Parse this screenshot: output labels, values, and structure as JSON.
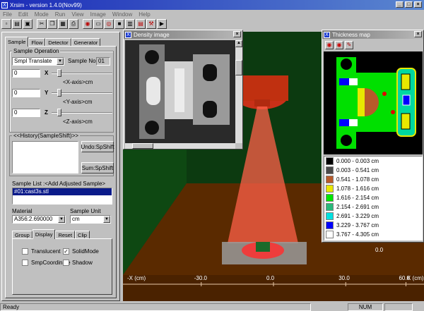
{
  "app": {
    "title": "Xrsim - version 1.4.0(Nov99)",
    "icon": "xray-app-icon"
  },
  "menu": [
    "File",
    "Edit",
    "Mode",
    "Run",
    "View",
    "Image",
    "Window",
    "Help"
  ],
  "toolbar": {
    "icons": [
      "new-icon",
      "open-icon",
      "save-icon",
      "cut-icon",
      "copy-icon",
      "paste-icon",
      "print-icon",
      "camera-icon",
      "display-icon",
      "record-icon",
      "stop-icon",
      "wall-icon",
      "film-icon",
      "tool-icon",
      "play-icon"
    ]
  },
  "left_panel": {
    "tabs": [
      "Sample",
      "Flow",
      "Detector",
      "Generator"
    ],
    "sample_operation": {
      "legend": "Sample Operation",
      "select_value": "Smpl Translate",
      "sample_no_label": "Sample No",
      "sample_no_value": "01"
    },
    "axes": [
      {
        "value": "0",
        "axis": "X",
        "caption": "<X-axis>cm"
      },
      {
        "value": "0",
        "axis": "Y",
        "caption": "<Y-axis>cm"
      },
      {
        "value": "0",
        "axis": "Z",
        "caption": "<Z-axis>cm"
      }
    ],
    "history": {
      "legend": "<<History(SampleShift)>>",
      "undo": "Undo:SpShift",
      "sum": "Sum:SpShift"
    },
    "sample_list": {
      "label": "Sample List :<Add Adjusted Sample>",
      "items": [
        "#01:cast3s.stl"
      ]
    },
    "material": {
      "label": "Material",
      "value": "A356:2.690000"
    },
    "sample_unit": {
      "label": "Sample Unit",
      "value": "cm"
    },
    "sub_tabs": [
      "Group",
      "Display",
      "Reset",
      "Clip"
    ],
    "checks": [
      {
        "label": "Translucent",
        "checked": false
      },
      {
        "label": "SolidMode",
        "checked": true
      },
      {
        "label": "SmpCoordinate",
        "checked": false
      },
      {
        "label": "Shadow",
        "checked": false
      }
    ]
  },
  "density_window": {
    "title": "Density image"
  },
  "thickness_window": {
    "title": "Thickness map",
    "legend": [
      {
        "color": "#000000",
        "label": "0.000 - 0.003 cm"
      },
      {
        "color": "#4a4a4a",
        "label": "0.003 - 0.541 cm"
      },
      {
        "color": "#b85a2a",
        "label": "0.541 - 1.078 cm"
      },
      {
        "color": "#e8e800",
        "label": "1.078 - 1.616 cm"
      },
      {
        "color": "#00e600",
        "label": "1.616 - 2.154 cm"
      },
      {
        "color": "#2ab87a",
        "label": "2.154 - 2.691 cm"
      },
      {
        "color": "#00e0e0",
        "label": "2.691 - 3.229 cm"
      },
      {
        "color": "#0000ff",
        "label": "3.229 - 3.767 cm"
      },
      {
        "color": "#ffffff",
        "label": "3.767 - 4.305 cm"
      }
    ]
  },
  "scene": {
    "x_label": "-X (cm)",
    "ticks": [
      "-30.0",
      "0.0",
      "30.0",
      "60.0"
    ],
    "tick_fracs": [
      0.26,
      0.5,
      0.74,
      0.94
    ],
    "k_label": "K (cm)",
    "right_value": "0.0"
  },
  "status": {
    "left": "Ready",
    "num": "NUM"
  }
}
